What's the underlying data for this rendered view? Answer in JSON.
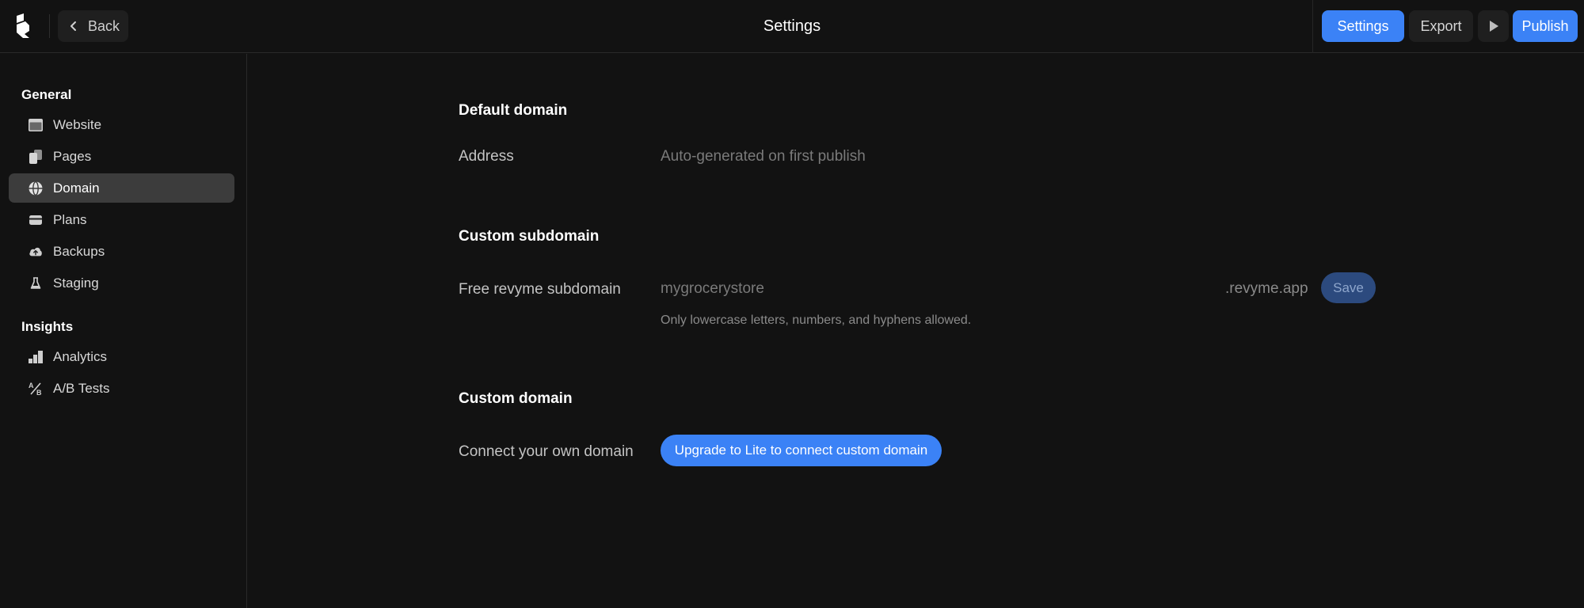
{
  "header": {
    "back_label": "Back",
    "title": "Settings",
    "settings_label": "Settings",
    "export_label": "Export",
    "publish_label": "Publish",
    "accent_color": "#3b82f6"
  },
  "sidebar": {
    "general_label": "General",
    "general_items": [
      {
        "label": "Website",
        "icon": "browser-window-icon"
      },
      {
        "label": "Pages",
        "icon": "pages-icon"
      },
      {
        "label": "Domain",
        "icon": "globe-icon",
        "active": true
      },
      {
        "label": "Plans",
        "icon": "credit-card-icon"
      },
      {
        "label": "Backups",
        "icon": "cloud-upload-icon"
      },
      {
        "label": "Staging",
        "icon": "flask-icon"
      }
    ],
    "insights_label": "Insights",
    "insights_items": [
      {
        "label": "Analytics",
        "icon": "bar-chart-icon"
      },
      {
        "label": "A/B Tests",
        "icon": "percent-icon"
      }
    ]
  },
  "main": {
    "default_domain": {
      "heading": "Default domain",
      "address_label": "Address",
      "address_value": "Auto-generated on first publish"
    },
    "custom_subdomain": {
      "heading": "Custom subdomain",
      "label": "Free revyme subdomain",
      "placeholder": "mygrocerystore",
      "suffix": ".revyme.app",
      "save_label": "Save",
      "hint": "Only lowercase letters, numbers, and hyphens allowed."
    },
    "custom_domain": {
      "heading": "Custom domain",
      "label": "Connect your own domain",
      "upgrade_label": "Upgrade to Lite to connect custom domain"
    }
  }
}
